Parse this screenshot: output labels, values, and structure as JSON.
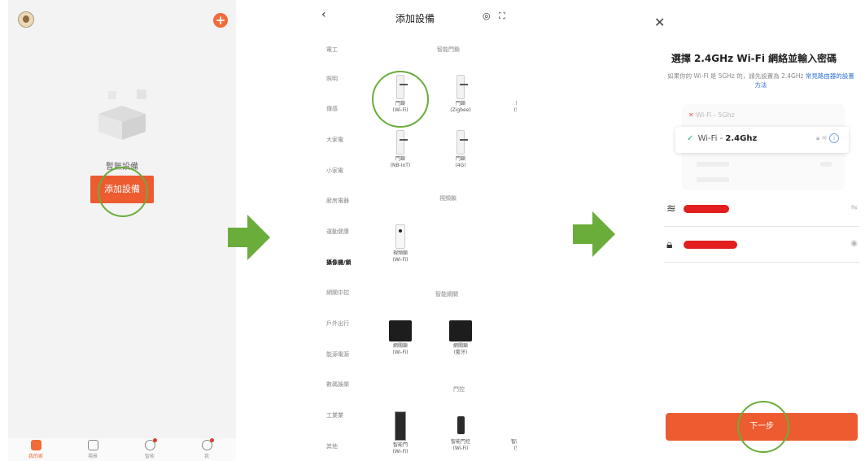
{
  "panel1": {
    "empty_text": "暫無設備",
    "add_button": "添加設備",
    "tabs": [
      {
        "label": "我的家",
        "icon": "home-icon",
        "active": true
      },
      {
        "label": "場景",
        "icon": "scene-icon",
        "active": false
      },
      {
        "label": "智能",
        "icon": "smart-icon",
        "active": false,
        "badge": true
      },
      {
        "label": "我",
        "icon": "profile-icon",
        "active": false,
        "badge": true
      }
    ],
    "accent": "#ed5b30"
  },
  "panel2": {
    "title": "添加設備",
    "back_icon": "back-chevron-icon",
    "categories": [
      "電工",
      "照明",
      "傳感",
      "大家電",
      "小家電",
      "廚房電器",
      "運動健康",
      "攝像機/鎖",
      "網關中控",
      "戶外出行",
      "能源電源",
      "數碼娛樂",
      "工業業",
      "其他"
    ],
    "selected_category": "攝像機/鎖",
    "sections": [
      "智能門鎖",
      "視頻鎖",
      "智能網關",
      "門控"
    ],
    "devices": {
      "lock_wifi": "門鎖\n(Wi-Fi)",
      "lock_zigbee": "門鎖\n(Zigbee)",
      "lock_bt": "門鎖\n(藍牙)",
      "lock_nbiot": "門鎖\n(NB-IoT)",
      "lock_4g": "門鎖\n(4G)",
      "video_lock": "視頻鎖\n(Wi-Fi)",
      "gw_wifi": "網關鎖\n(Wi-Fi)",
      "gw_bt": "網關鎖\n(藍牙)",
      "door_wifi": "智能門\n(Wi-Fi)",
      "door_wifi2": "智能門控\n(Wi-Fi)",
      "door_bt": "智能門控\n(藍牙)"
    }
  },
  "panel3": {
    "title": "選擇 2.4GHz Wi-Fi 網絡並輸入密碼",
    "subtitle": "如果你的 Wi-Fi 是 5GHz 的，請先設置為 2.4GHz",
    "subtitle_link": "常見路由器的設置方法",
    "net_5g": "Wi-Fi - 5Ghz",
    "net_24_prefix": "Wi-Fi - ",
    "net_24_band": "2.4Ghz",
    "next_button": "下一步",
    "redaction_color": "#e21e1e"
  }
}
